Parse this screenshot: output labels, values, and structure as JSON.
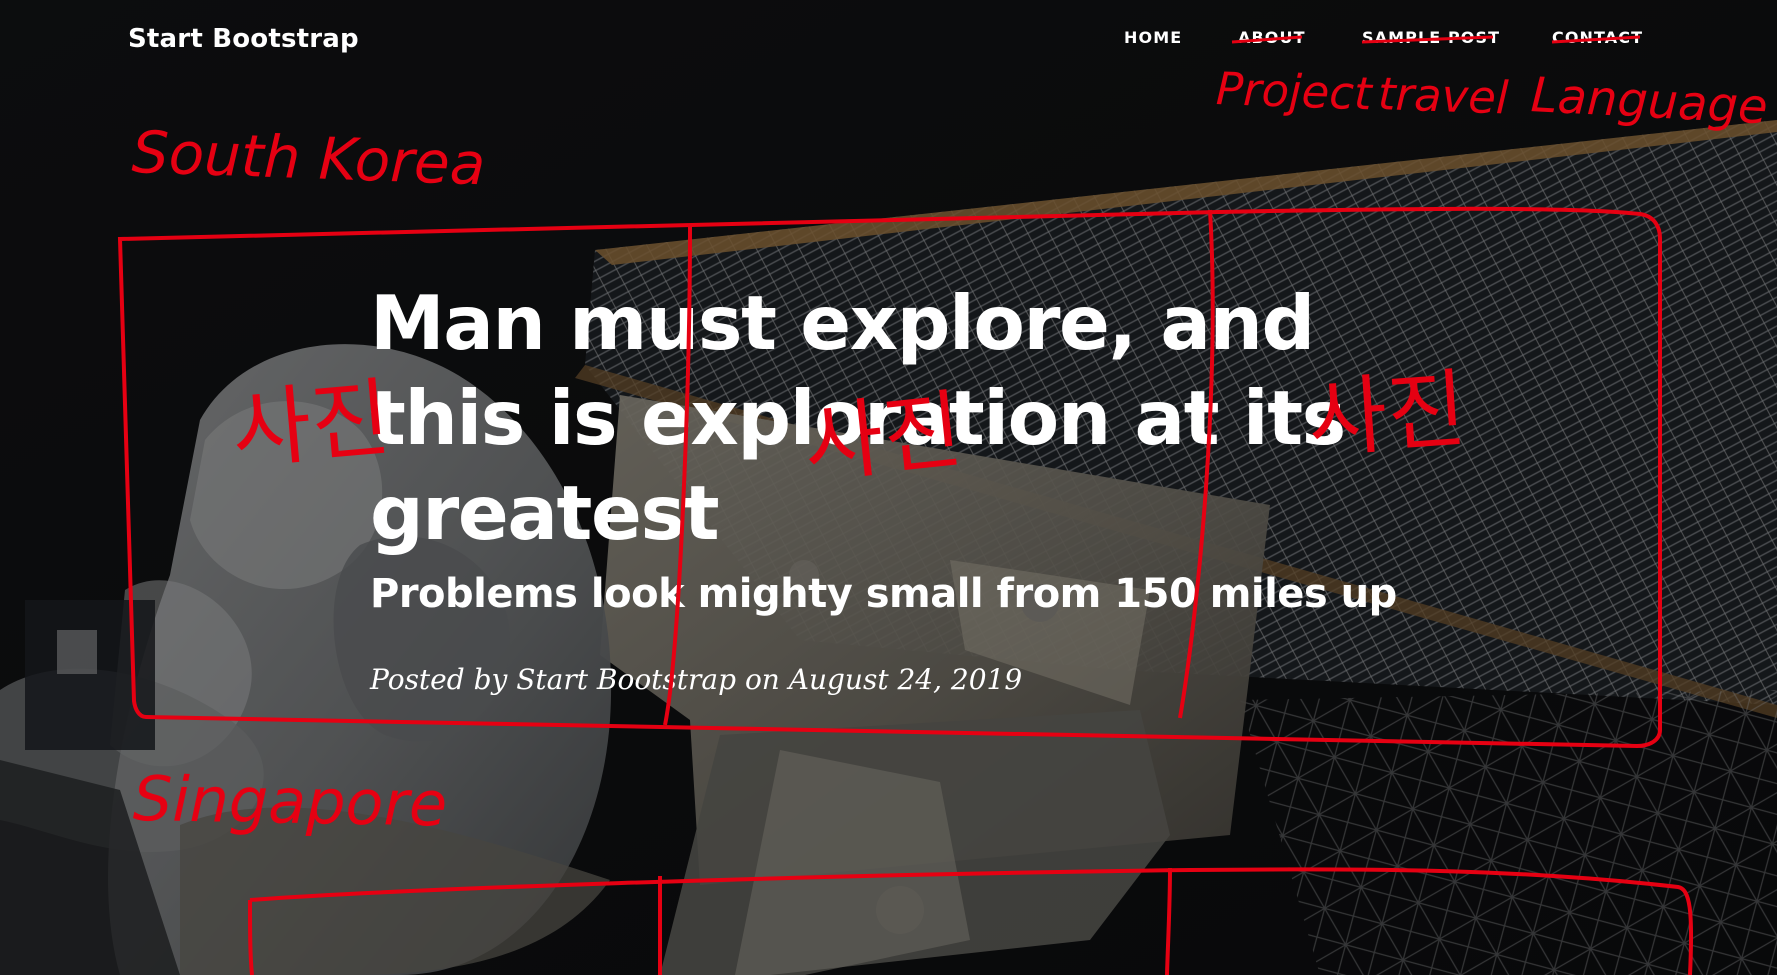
{
  "navbar": {
    "brand": "Start Bootstrap",
    "links": [
      "Home",
      "About",
      "Sample Post",
      "Contact"
    ]
  },
  "header": {
    "title": "Man must explore, and this is exploration at its greatest",
    "subtitle": "Problems look mighty small from 150 miles up",
    "meta": "Posted by Start Bootstrap on August 24, 2019"
  },
  "annotations": {
    "region_title": "South Korea",
    "nav_items": [
      "Project",
      "travel",
      "Language"
    ],
    "card_placeholder": "사진",
    "section_title": "Singapore"
  },
  "colors": {
    "annotation": "#e60012",
    "overlay": "#000000",
    "text": "#ffffff"
  },
  "icons": {
    "hero_image": "astronaut-space-station-image"
  }
}
